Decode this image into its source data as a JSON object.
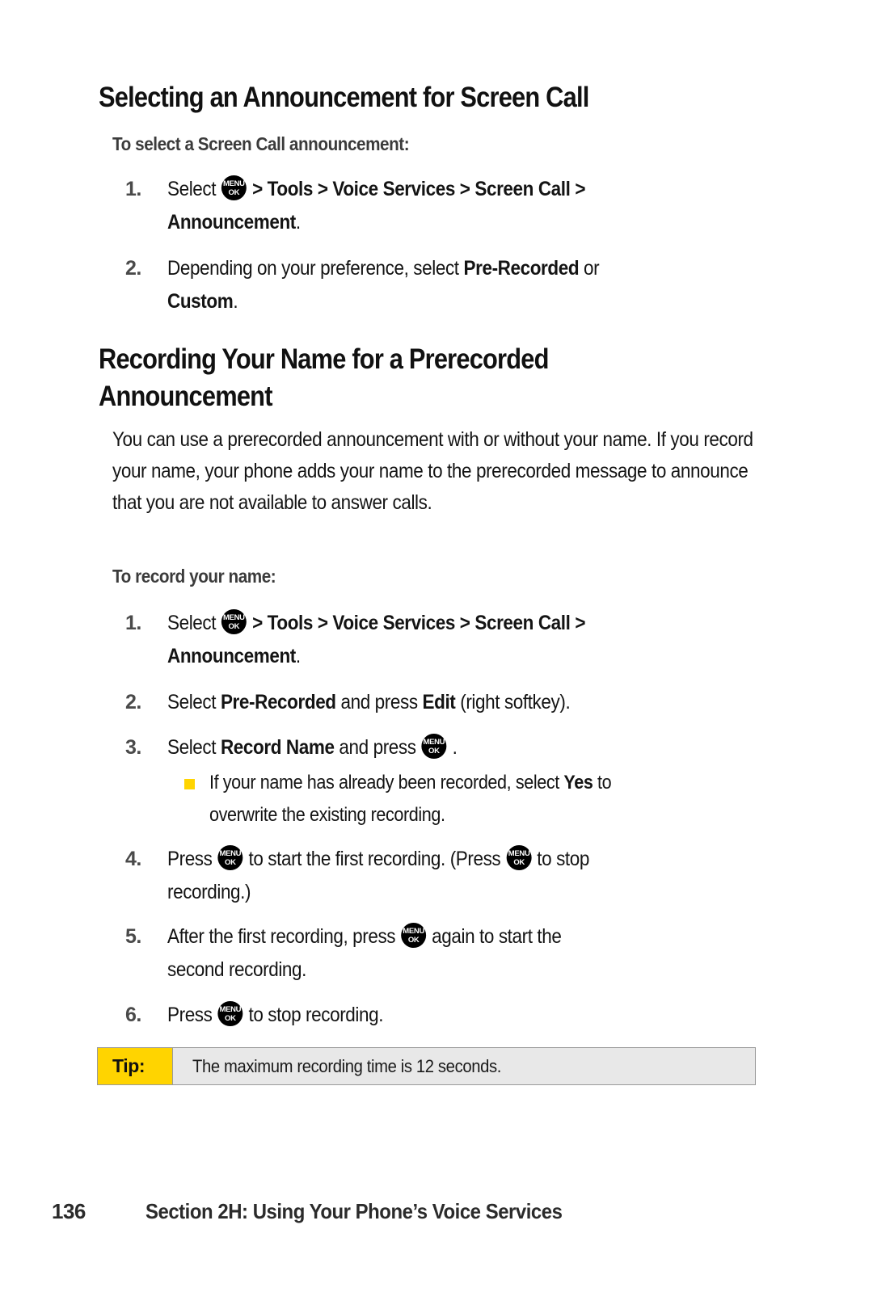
{
  "document": {
    "page_number": "136",
    "footer_title": "Section 2H: Using Your Phone’s Voice Services"
  },
  "icons": {
    "menu_key": {
      "top_label": "MENU",
      "bottom_label": "OK",
      "name": "menu-ok-key-icon"
    }
  },
  "colors": {
    "accent_yellow": "#FFD400",
    "tip_background": "#e8e8e8",
    "tip_border": "#9a9a9a",
    "heading": "#111111",
    "body_text": "#141414",
    "subhead": "#3b3b3b"
  },
  "section1": {
    "heading": "Selecting an Announcement for Screen Call",
    "subheading": "To select a Screen Call announcement:",
    "steps": [
      {
        "number": "1.",
        "pre": "Select ",
        "post_bold": "> Tools > Voice Services > Screen Call >",
        "line2_bold": "Announcement",
        "line2_tail": "."
      },
      {
        "number": "2.",
        "text_before": "Depending on your preference, select ",
        "bold1": "Pre-Recorded",
        "text_mid": " or",
        "bold2": "Custom",
        "text_after": "."
      }
    ]
  },
  "section2": {
    "heading_line1": "Recording Your Name for a Prerecorded",
    "heading_line2": "Announcement",
    "paragraph": "You can use a prerecorded announcement with or without your name. If you record your name, your phone adds your name to the prerecorded message to announce that you are not available to answer calls.",
    "subheading": "To record your name:",
    "steps": [
      {
        "number": "1.",
        "pre": "Select ",
        "post_bold": "> Tools > Voice Services > Screen Call >",
        "line2_bold": "Announcement",
        "line2_tail": "."
      },
      {
        "number": "2.",
        "t1": "Select ",
        "b1": "Pre-Recorded",
        "t2": " and press ",
        "b2": "Edit",
        "t3": " (right softkey)."
      },
      {
        "number": "3.",
        "t1": "Select ",
        "b1": "Record Name",
        "t2": " and press ",
        "t3": "."
      },
      {
        "number": "4.",
        "t1": "Press ",
        "t2": " to start the first recording. (Press ",
        "t3": " to stop",
        "line2": "recording.)"
      },
      {
        "number": "5.",
        "t1": "After the first recording, press ",
        "t2": " again to start the",
        "line2": "second recording."
      },
      {
        "number": "6.",
        "t1": "Press ",
        "t2": " to stop recording."
      }
    ],
    "sub_bullet": {
      "t1": "If your name has already been recorded, select ",
      "b1": "Yes",
      "t2": " to",
      "line2": "overwrite the existing recording."
    }
  },
  "tip": {
    "label": "Tip:",
    "text": "The maximum recording time is 12 seconds."
  }
}
